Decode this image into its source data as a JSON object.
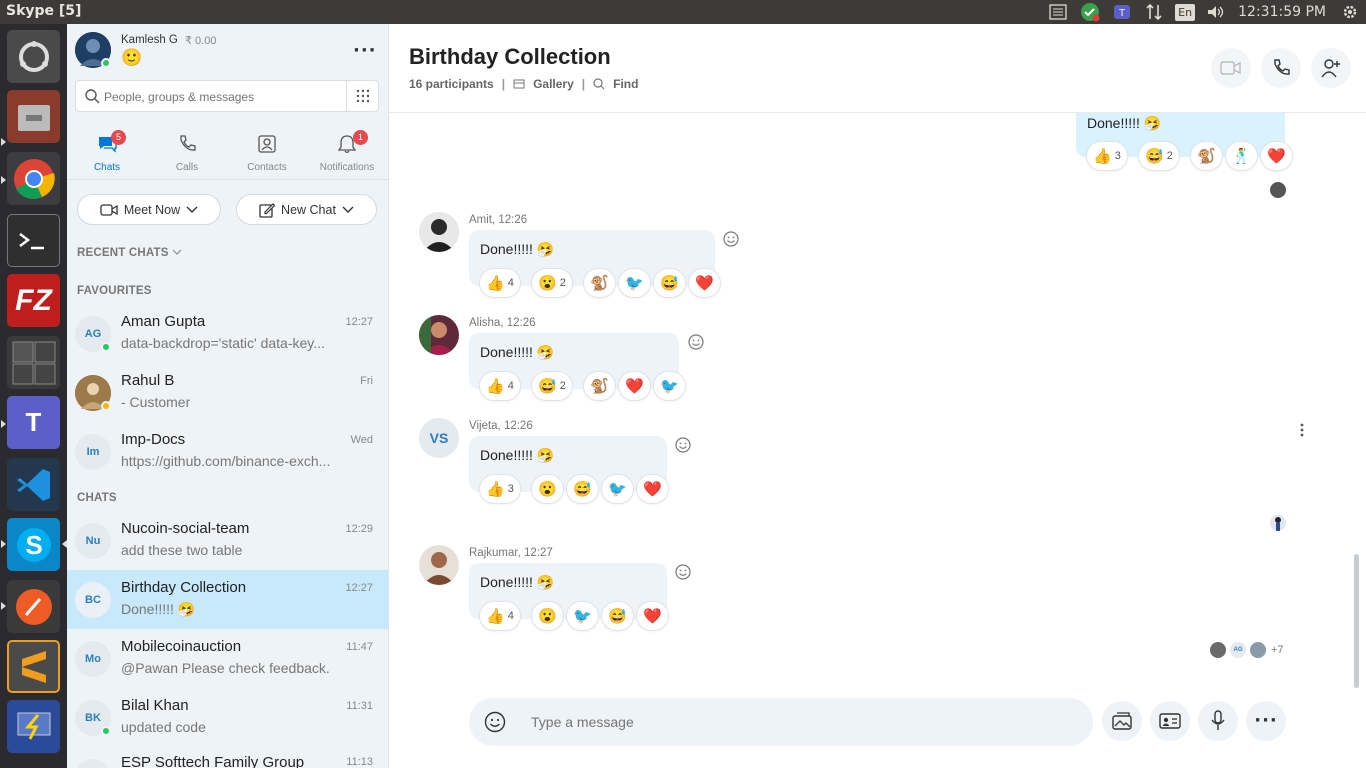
{
  "window": {
    "title": "Skype [5]"
  },
  "tray": {
    "keyboard": "En",
    "clock": "12:31:59 PM"
  },
  "profile": {
    "name": "Kamlesh G",
    "credit": "₹ 0.00",
    "mood": "🙂"
  },
  "search": {
    "placeholder": "People, groups & messages"
  },
  "nav": {
    "tabs": [
      {
        "label": "Chats",
        "badge": "5"
      },
      {
        "label": "Calls"
      },
      {
        "label": "Contacts"
      },
      {
        "label": "Notifications",
        "badge": "1"
      }
    ]
  },
  "actions": {
    "meet_now": "Meet Now",
    "new_chat": "New Chat"
  },
  "sections": {
    "recent": "RECENT CHATS",
    "favourites": "FAVOURITES",
    "chats": "CHATS"
  },
  "favourites": [
    {
      "initials": "AG",
      "name": "Aman Gupta",
      "time": "12:27",
      "preview": "data-backdrop='static' data-key..."
    },
    {
      "initials": "",
      "name": "Rahul B",
      "time": "Fri",
      "preview": "- Customer"
    },
    {
      "initials": "Im",
      "name": "Imp-Docs",
      "time": "Wed",
      "preview": "https://github.com/binance-exch..."
    }
  ],
  "chats": [
    {
      "initials": "Nu",
      "name": "Nucoin-social-team",
      "time": "12:29",
      "preview": "add these two table"
    },
    {
      "initials": "BC",
      "name": "Birthday Collection",
      "time": "12:27",
      "preview": "Done!!!!! 🤧"
    },
    {
      "initials": "Mo",
      "name": "Mobilecoinauction",
      "time": "11:47",
      "preview": "@Pawan Please check feedback."
    },
    {
      "initials": "BK",
      "name": "Bilal Khan",
      "time": "11:31",
      "preview": "updated code"
    },
    {
      "initials": "",
      "name": "ESP Softtech Family Group",
      "time": "11:13",
      "preview": ""
    }
  ],
  "conversation": {
    "title": "Birthday Collection",
    "participants": "16 participants",
    "gallery": "Gallery",
    "find": "Find",
    "own_message": {
      "text": "Done!!!!! 🤧",
      "reactions": [
        {
          "emoji": "👍",
          "count": "3"
        },
        {
          "emoji": "😅",
          "count": "2"
        },
        {
          "emoji": "🐒",
          "count": ""
        },
        {
          "emoji": "🕺",
          "count": ""
        },
        {
          "emoji": "❤️",
          "count": ""
        }
      ]
    },
    "messages": [
      {
        "sender": "Amit, 12:26",
        "initials": "",
        "text": "Done!!!!! 🤧",
        "reactions": [
          {
            "emoji": "👍",
            "count": "4"
          },
          {
            "emoji": "😮",
            "count": "2"
          },
          {
            "emoji": "🐒",
            "count": ""
          },
          {
            "emoji": "🐦",
            "count": ""
          },
          {
            "emoji": "😅",
            "count": ""
          },
          {
            "emoji": "❤️",
            "count": ""
          }
        ]
      },
      {
        "sender": "Alisha, 12:26",
        "initials": "",
        "text": "Done!!!!! 🤧",
        "reactions": [
          {
            "emoji": "👍",
            "count": "4"
          },
          {
            "emoji": "😅",
            "count": "2"
          },
          {
            "emoji": "🐒",
            "count": ""
          },
          {
            "emoji": "❤️",
            "count": ""
          },
          {
            "emoji": "🐦",
            "count": ""
          }
        ]
      },
      {
        "sender": "Vijeta, 12:26",
        "initials": "VS",
        "text": "Done!!!!! 🤧",
        "reactions": [
          {
            "emoji": "👍",
            "count": "3"
          },
          {
            "emoji": "😮",
            "count": ""
          },
          {
            "emoji": "😅",
            "count": ""
          },
          {
            "emoji": "🐦",
            "count": ""
          },
          {
            "emoji": "❤️",
            "count": ""
          }
        ]
      },
      {
        "sender": "Rajkumar, 12:27",
        "initials": "",
        "text": "Done!!!!! 🤧",
        "reactions": [
          {
            "emoji": "👍",
            "count": "4"
          },
          {
            "emoji": "😮",
            "count": ""
          },
          {
            "emoji": "🐦",
            "count": ""
          },
          {
            "emoji": "😅",
            "count": ""
          },
          {
            "emoji": "❤️",
            "count": ""
          }
        ]
      }
    ],
    "seen_by": {
      "initials": "AG",
      "more": "+7"
    }
  },
  "composer": {
    "placeholder": "Type a message"
  },
  "colors": {
    "accent": "#0078d4",
    "selected": "#c7e9fb",
    "badge": "#e5484d",
    "online": "#2ec45e"
  }
}
